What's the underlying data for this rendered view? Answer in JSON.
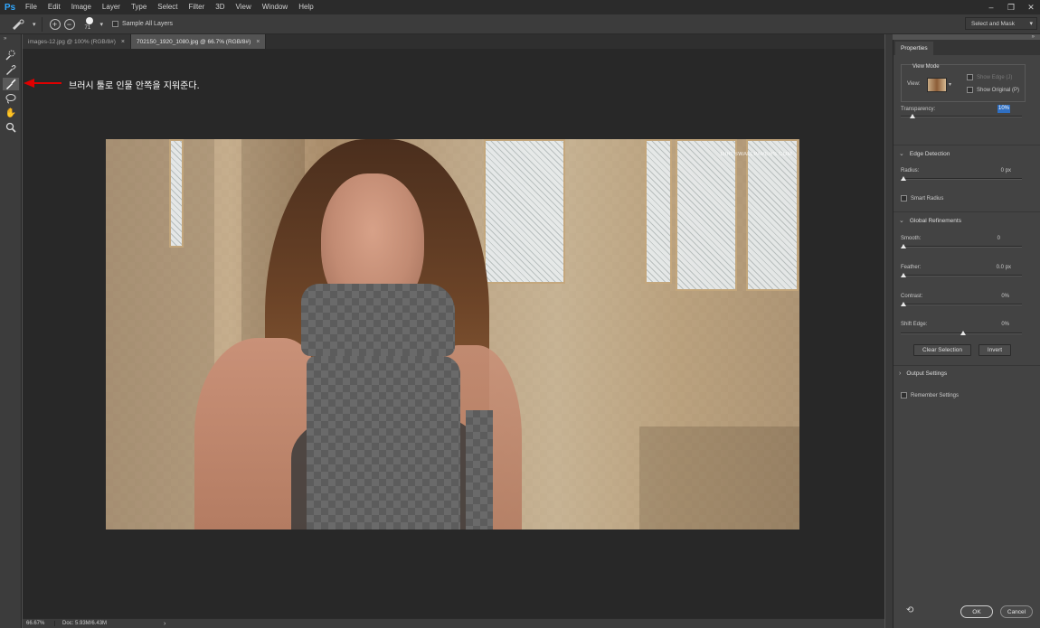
{
  "menubar": {
    "logo": "Ps",
    "items": [
      "File",
      "Edit",
      "Image",
      "Layer",
      "Type",
      "Select",
      "Filter",
      "3D",
      "View",
      "Window",
      "Help"
    ],
    "window_controls": [
      "–",
      "❐",
      "✕"
    ]
  },
  "options": {
    "brush_size": "71",
    "sample_all_layers": "Sample All Layers",
    "select_and_mask": "Select and Mask"
  },
  "tabs": [
    {
      "label": "images-12.jpg @ 100% (RGB/8#)",
      "close": "×"
    },
    {
      "label": "702150_1920_1080.jpg @ 66.7% (RGB/8#)",
      "close": "×"
    }
  ],
  "annotation": {
    "text": "브러시 툴로 인물 안쪽을 지워준다.",
    "arrow_color": "#e00000"
  },
  "photo": {
    "watermark": "GIRLSWALLPAPERS.COM"
  },
  "statusbar": {
    "zoom": "66.67%",
    "doc": "Doc: 5.93M/6.43M",
    "more": "›"
  },
  "properties": {
    "tab": "Properties",
    "view_mode": {
      "title": "View Mode",
      "view_label": "View:",
      "show_edge": "Show Edge (J)",
      "show_original": "Show Original (P)"
    },
    "transparency": {
      "label": "Transparency:",
      "value": "10%",
      "level": 0.1
    },
    "edge_detection": {
      "title": "Edge Detection",
      "radius_label": "Radius:",
      "radius_value": "0 px",
      "smart_radius": "Smart Radius"
    },
    "global_refinements": {
      "title": "Global Refinements",
      "smooth_label": "Smooth:",
      "smooth_value": "0",
      "feather_label": "Feather:",
      "feather_value": "0.0 px",
      "contrast_label": "Contrast:",
      "contrast_value": "0%",
      "shift_label": "Shift Edge:",
      "shift_value": "0%"
    },
    "buttons": {
      "clear": "Clear Selection",
      "invert": "Invert"
    },
    "output_settings": "Output Settings",
    "remember_settings": "Remember Settings",
    "ok": "OK",
    "cancel": "Cancel"
  }
}
